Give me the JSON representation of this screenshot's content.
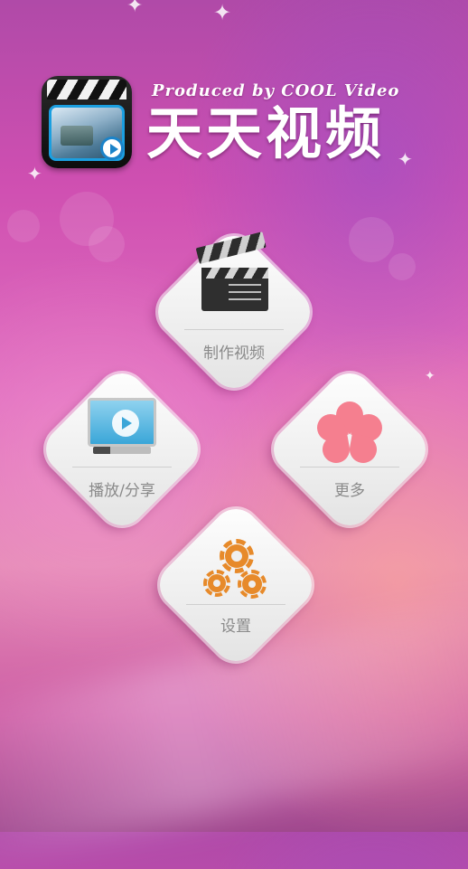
{
  "header": {
    "tagline": "Produced by COOL Video",
    "app_title": "天天视频"
  },
  "menu": {
    "items": [
      {
        "label": "制作视频",
        "icon": "clapperboard-icon"
      },
      {
        "label": "播放/分享",
        "icon": "monitor-play-icon"
      },
      {
        "label": "更多",
        "icon": "flower-icon"
      },
      {
        "label": "设置",
        "icon": "gears-icon"
      }
    ]
  },
  "colors": {
    "background_top": "#b04aa8",
    "background_mid": "#e06fbf",
    "tile": "#f2f2f2",
    "label": "#8a8a8a",
    "flower": "#f57f8f",
    "gears": "#e78a2a",
    "monitor": "#3aa6d8"
  }
}
